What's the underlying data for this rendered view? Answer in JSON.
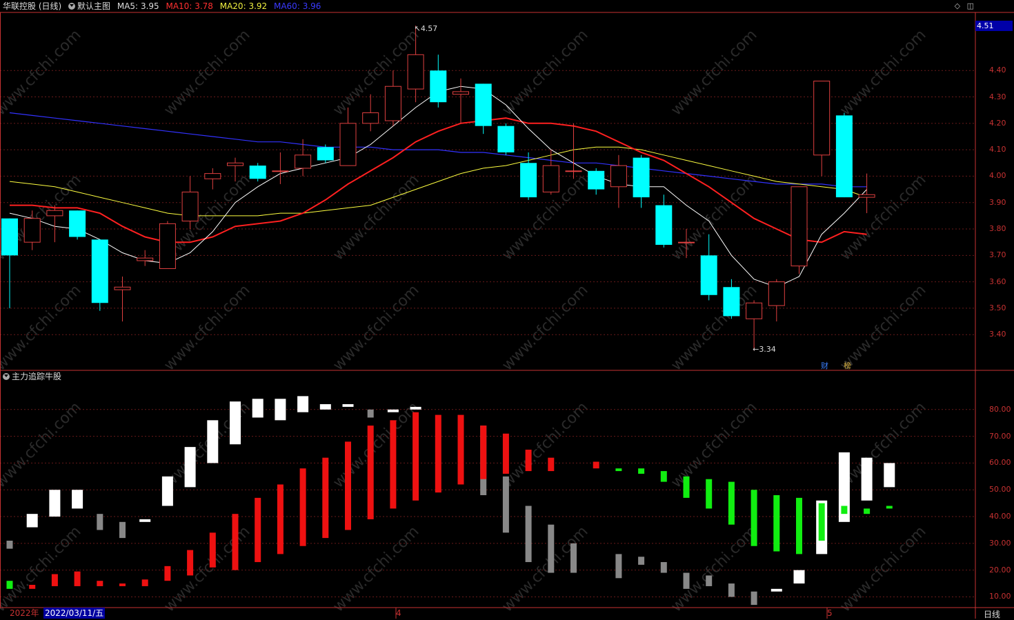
{
  "header": {
    "stock": "华联控股 (日线)",
    "template": "默认主图",
    "ma5_label": "MA5:",
    "ma5_value": "3.95",
    "ma10_label": "MA10:",
    "ma10_value": "3.78",
    "ma20_label": "MA20:",
    "ma20_value": "3.92",
    "ma60_label": "MA60:",
    "ma60_value": "3.96"
  },
  "colors": {
    "ma5": "#ffffff",
    "ma10": "#ff2020",
    "ma20": "#ffff40",
    "ma60": "#3232ff",
    "up": "#e04040",
    "down": "#00ffff"
  },
  "current_price": "4.51",
  "high_label": "4.57",
  "low_label": "3.34",
  "tags": {
    "cai": "财",
    "bang": "榜"
  },
  "sub_indicator": {
    "name": "主力追踪牛股"
  },
  "footer": {
    "year": "2022年",
    "selected_date": "2022/03/11/五",
    "month4": "4",
    "month5": "5",
    "period": "日线"
  },
  "watermark": "www.cfchi.com",
  "chart_data": [
    {
      "type": "candlestick",
      "ylim": [
        3.27,
        4.62
      ],
      "yticks": [
        "4.40",
        "4.30",
        "4.20",
        "4.10",
        "4.00",
        "3.90",
        "3.80",
        "3.70",
        "3.60",
        "3.50",
        "3.40"
      ],
      "candles": [
        {
          "o": 3.84,
          "c": 3.7,
          "h": 3.84,
          "l": 3.5
        },
        {
          "o": 3.75,
          "c": 3.84,
          "h": 3.87,
          "l": 3.72
        },
        {
          "o": 3.85,
          "c": 3.87,
          "h": 3.89,
          "l": 3.75
        },
        {
          "o": 3.87,
          "c": 3.77,
          "h": 3.87,
          "l": 3.76
        },
        {
          "o": 3.76,
          "c": 3.52,
          "h": 3.76,
          "l": 3.49
        },
        {
          "o": 3.57,
          "c": 3.58,
          "h": 3.62,
          "l": 3.45
        },
        {
          "o": 3.68,
          "c": 3.69,
          "h": 3.72,
          "l": 3.66
        },
        {
          "o": 3.65,
          "c": 3.82,
          "h": 3.83,
          "l": 3.65
        },
        {
          "o": 3.83,
          "c": 3.94,
          "h": 4.0,
          "l": 3.8
        },
        {
          "o": 3.99,
          "c": 4.01,
          "h": 4.03,
          "l": 3.95
        },
        {
          "o": 4.04,
          "c": 4.05,
          "h": 4.07,
          "l": 3.98
        },
        {
          "o": 4.04,
          "c": 3.99,
          "h": 4.05,
          "l": 3.98
        },
        {
          "o": 4.02,
          "c": 4.02,
          "h": 4.09,
          "l": 3.97
        },
        {
          "o": 4.03,
          "c": 4.08,
          "h": 4.14,
          "l": 4.0
        },
        {
          "o": 4.11,
          "c": 4.06,
          "h": 4.12,
          "l": 4.05
        },
        {
          "o": 4.04,
          "c": 4.2,
          "h": 4.26,
          "l": 4.04
        },
        {
          "o": 4.2,
          "c": 4.24,
          "h": 4.31,
          "l": 4.17
        },
        {
          "o": 4.21,
          "c": 4.34,
          "h": 4.4,
          "l": 4.19
        },
        {
          "o": 4.33,
          "c": 4.46,
          "h": 4.57,
          "l": 4.28
        },
        {
          "o": 4.4,
          "c": 4.28,
          "h": 4.46,
          "l": 4.26
        },
        {
          "o": 4.31,
          "c": 4.32,
          "h": 4.37,
          "l": 4.2
        },
        {
          "o": 4.35,
          "c": 4.19,
          "h": 4.35,
          "l": 4.16
        },
        {
          "o": 4.19,
          "c": 4.09,
          "h": 4.2,
          "l": 4.08
        },
        {
          "o": 4.05,
          "c": 3.92,
          "h": 4.09,
          "l": 3.91
        },
        {
          "o": 3.94,
          "c": 4.04,
          "h": 4.1,
          "l": 3.93
        },
        {
          "o": 4.02,
          "c": 4.02,
          "h": 4.2,
          "l": 3.99
        },
        {
          "o": 4.02,
          "c": 3.95,
          "h": 4.03,
          "l": 3.93
        },
        {
          "o": 3.96,
          "c": 4.04,
          "h": 4.08,
          "l": 3.88
        },
        {
          "o": 4.07,
          "c": 3.92,
          "h": 4.08,
          "l": 3.88
        },
        {
          "o": 3.89,
          "c": 3.74,
          "h": 3.93,
          "l": 3.73
        },
        {
          "o": 3.75,
          "c": 3.75,
          "h": 3.8,
          "l": 3.69
        },
        {
          "o": 3.7,
          "c": 3.55,
          "h": 3.78,
          "l": 3.53
        },
        {
          "o": 3.58,
          "c": 3.47,
          "h": 3.61,
          "l": 3.46
        },
        {
          "o": 3.46,
          "c": 3.52,
          "h": 3.53,
          "l": 3.34
        },
        {
          "o": 3.51,
          "c": 3.6,
          "h": 3.61,
          "l": 3.45
        },
        {
          "o": 3.66,
          "c": 3.96,
          "h": 3.96,
          "l": 3.63
        },
        {
          "o": 4.08,
          "c": 4.36,
          "h": 4.36,
          "l": 4.0
        },
        {
          "o": 4.23,
          "c": 3.92,
          "h": 4.24,
          "l": 3.92
        },
        {
          "o": 3.92,
          "c": 3.93,
          "h": 4.01,
          "l": 3.86
        }
      ],
      "ma5": [
        3.86,
        3.84,
        3.81,
        3.8,
        3.76,
        3.71,
        3.68,
        3.67,
        3.71,
        3.79,
        3.9,
        3.96,
        4.01,
        4.03,
        4.05,
        4.07,
        4.12,
        4.19,
        4.26,
        4.32,
        4.34,
        4.33,
        4.27,
        4.18,
        4.1,
        4.05,
        4.0,
        3.97,
        3.96,
        3.96,
        3.89,
        3.83,
        3.7,
        3.61,
        3.58,
        3.62,
        3.78,
        3.86,
        3.95
      ],
      "ma10": [
        3.89,
        3.89,
        3.88,
        3.88,
        3.86,
        3.81,
        3.77,
        3.75,
        3.75,
        3.77,
        3.81,
        3.82,
        3.83,
        3.86,
        3.91,
        3.97,
        4.02,
        4.07,
        4.13,
        4.17,
        4.2,
        4.21,
        4.22,
        4.2,
        4.2,
        4.19,
        4.17,
        4.13,
        4.09,
        4.06,
        4.01,
        3.96,
        3.9,
        3.84,
        3.8,
        3.76,
        3.75,
        3.79,
        3.78
      ],
      "ma20": [
        3.98,
        3.97,
        3.96,
        3.94,
        3.92,
        3.9,
        3.88,
        3.86,
        3.85,
        3.85,
        3.85,
        3.85,
        3.86,
        3.86,
        3.87,
        3.88,
        3.89,
        3.92,
        3.95,
        3.98,
        4.01,
        4.03,
        4.04,
        4.06,
        4.08,
        4.1,
        4.11,
        4.11,
        4.1,
        4.08,
        4.06,
        4.04,
        4.02,
        4.0,
        3.98,
        3.97,
        3.96,
        3.95,
        3.92
      ],
      "ma60": [
        4.24,
        4.23,
        4.22,
        4.21,
        4.2,
        4.19,
        4.18,
        4.17,
        4.16,
        4.15,
        4.14,
        4.13,
        4.13,
        4.12,
        4.11,
        4.11,
        4.11,
        4.1,
        4.1,
        4.1,
        4.09,
        4.09,
        4.08,
        4.07,
        4.06,
        4.05,
        4.05,
        4.04,
        4.03,
        4.02,
        4.01,
        4.0,
        3.99,
        3.98,
        3.97,
        3.97,
        3.97,
        3.96,
        3.96
      ]
    },
    {
      "type": "bar",
      "ylim": [
        6,
        90
      ],
      "yticks": [
        "80.00",
        "70.00",
        "60.00",
        "50.00",
        "40.00",
        "30.00",
        "20.00",
        "10.00"
      ],
      "groups": [
        [
          {
            "lo": 13,
            "hi": 16,
            "c": "green"
          },
          {
            "lo": 28,
            "hi": 31,
            "c": "gray"
          }
        ],
        [
          {
            "lo": 13,
            "hi": 14.5,
            "c": "red"
          },
          {
            "lo": 36,
            "hi": 41,
            "c": "white"
          }
        ],
        [
          {
            "lo": 14,
            "hi": 18.5,
            "c": "red"
          },
          {
            "lo": 40,
            "hi": 50,
            "c": "white"
          }
        ],
        [
          {
            "lo": 14,
            "hi": 19.5,
            "c": "red"
          },
          {
            "lo": 43,
            "hi": 50,
            "c": "white"
          }
        ],
        [
          {
            "lo": 14,
            "hi": 16,
            "c": "red"
          },
          {
            "lo": 35,
            "hi": 41,
            "c": "gray"
          }
        ],
        [
          {
            "lo": 14,
            "hi": 15,
            "c": "red"
          },
          {
            "lo": 32,
            "hi": 38,
            "c": "gray"
          }
        ],
        [
          {
            "lo": 14,
            "hi": 16.5,
            "c": "red"
          },
          {
            "lo": 38,
            "hi": 39,
            "c": "white"
          }
        ],
        [
          {
            "lo": 16,
            "hi": 21.5,
            "c": "red"
          },
          {
            "lo": 44,
            "hi": 55,
            "c": "white"
          }
        ],
        [
          {
            "lo": 18,
            "hi": 27.5,
            "c": "red"
          },
          {
            "lo": 51,
            "hi": 66,
            "c": "white"
          }
        ],
        [
          {
            "lo": 21,
            "hi": 34,
            "c": "red"
          },
          {
            "lo": 60,
            "hi": 76,
            "c": "white"
          }
        ],
        [
          {
            "lo": 20,
            "hi": 41,
            "c": "red"
          },
          {
            "lo": 67,
            "hi": 83,
            "c": "white"
          }
        ],
        [
          {
            "lo": 23,
            "hi": 47,
            "c": "red"
          },
          {
            "lo": 77,
            "hi": 84,
            "c": "white"
          }
        ],
        [
          {
            "lo": 26,
            "hi": 52,
            "c": "red"
          },
          {
            "lo": 76,
            "hi": 84,
            "c": "white"
          }
        ],
        [
          {
            "lo": 29,
            "hi": 58,
            "c": "red"
          },
          {
            "lo": 79,
            "hi": 85,
            "c": "white"
          }
        ],
        [
          {
            "lo": 32,
            "hi": 62,
            "c": "red"
          },
          {
            "lo": 80,
            "hi": 82,
            "c": "white"
          }
        ],
        [
          {
            "lo": 35,
            "hi": 68,
            "c": "red"
          },
          {
            "lo": 81,
            "hi": 82,
            "c": "white"
          }
        ],
        [
          {
            "lo": 39,
            "hi": 74,
            "c": "red"
          },
          {
            "lo": 77,
            "hi": 80,
            "c": "gray"
          }
        ],
        [
          {
            "lo": 43,
            "hi": 76,
            "c": "red"
          },
          {
            "lo": 79,
            "hi": 80,
            "c": "white"
          }
        ],
        [
          {
            "lo": 46,
            "hi": 79,
            "c": "red"
          },
          {
            "lo": 80,
            "hi": 81,
            "c": "white"
          }
        ],
        [
          {
            "lo": 49,
            "hi": 78,
            "c": "red"
          }
        ],
        [
          {
            "lo": 52,
            "hi": 78,
            "c": "red"
          }
        ],
        [
          {
            "lo": 48,
            "hi": 74,
            "c": "gray"
          },
          {
            "lo": 54,
            "hi": 74,
            "c": "red"
          }
        ],
        [
          {
            "lo": 34,
            "hi": 55,
            "c": "gray"
          },
          {
            "lo": 56,
            "hi": 71,
            "c": "red"
          }
        ],
        [
          {
            "lo": 23,
            "hi": 44,
            "c": "gray"
          },
          {
            "lo": 57,
            "hi": 65,
            "c": "red"
          }
        ],
        [
          {
            "lo": 19,
            "hi": 37,
            "c": "gray"
          },
          {
            "lo": 57,
            "hi": 62,
            "c": "red"
          }
        ],
        [
          {
            "lo": 19,
            "hi": 30,
            "c": "gray"
          }
        ],
        [
          {
            "lo": 58,
            "hi": 60.5,
            "c": "red"
          }
        ],
        [
          {
            "lo": 17,
            "hi": 26,
            "c": "gray"
          },
          {
            "lo": 57,
            "hi": 58,
            "c": "green"
          }
        ],
        [
          {
            "lo": 22,
            "hi": 25,
            "c": "gray"
          },
          {
            "lo": 56,
            "hi": 58,
            "c": "green"
          }
        ],
        [
          {
            "lo": 19,
            "hi": 23,
            "c": "gray"
          },
          {
            "lo": 53,
            "hi": 57,
            "c": "green"
          }
        ],
        [
          {
            "lo": 13,
            "hi": 19,
            "c": "gray"
          },
          {
            "lo": 47,
            "hi": 55,
            "c": "green"
          }
        ],
        [
          {
            "lo": 14,
            "hi": 18,
            "c": "gray"
          },
          {
            "lo": 43,
            "hi": 54,
            "c": "green"
          }
        ],
        [
          {
            "lo": 10,
            "hi": 15,
            "c": "gray"
          },
          {
            "lo": 37,
            "hi": 53,
            "c": "green"
          }
        ],
        [
          {
            "lo": 7,
            "hi": 12,
            "c": "gray"
          },
          {
            "lo": 29,
            "hi": 50,
            "c": "green"
          }
        ],
        [
          {
            "lo": 12,
            "hi": 13,
            "c": "white"
          },
          {
            "lo": 27,
            "hi": 48,
            "c": "green"
          }
        ],
        [
          {
            "lo": 15,
            "hi": 20,
            "c": "white"
          },
          {
            "lo": 26,
            "hi": 47,
            "c": "green"
          }
        ],
        [
          {
            "lo": 26,
            "hi": 46,
            "c": "white"
          },
          {
            "lo": 31,
            "hi": 45,
            "c": "green"
          }
        ],
        [
          {
            "lo": 38,
            "hi": 64,
            "c": "white"
          },
          {
            "lo": 41,
            "hi": 44,
            "c": "green"
          }
        ],
        [
          {
            "lo": 46,
            "hi": 62,
            "c": "white"
          },
          {
            "lo": 41,
            "hi": 43,
            "c": "green"
          }
        ],
        [
          {
            "lo": 51,
            "hi": 60,
            "c": "white"
          },
          {
            "lo": 43,
            "hi": 44,
            "c": "green"
          }
        ]
      ]
    }
  ]
}
